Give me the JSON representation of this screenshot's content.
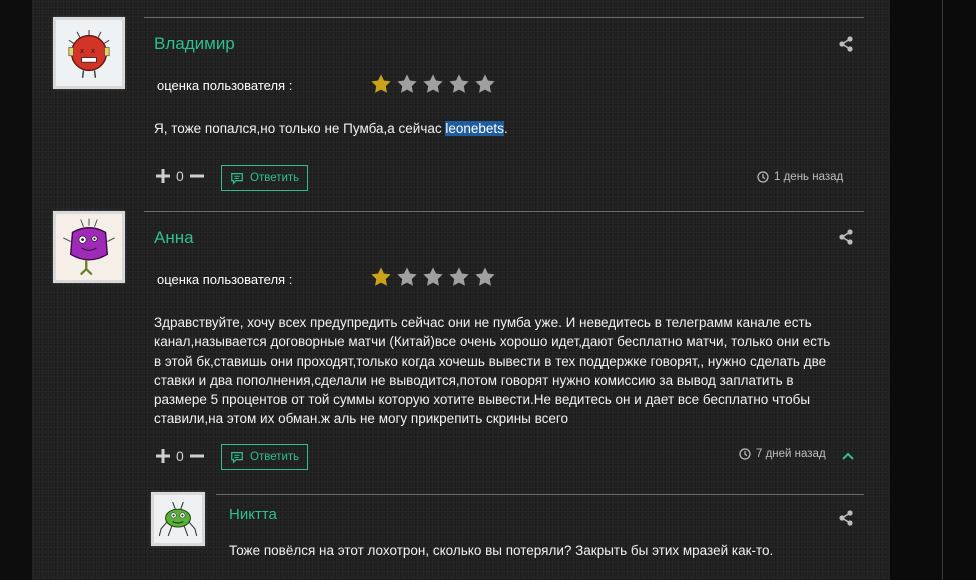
{
  "comments": [
    {
      "author": "Владимир",
      "rating_label": "оценка пользователя :",
      "rating": 1,
      "rating_max": 5,
      "text_before": "Я, тоже попался,но только не Пумба,а сейчас ",
      "text_highlight": "leonebets",
      "text_after": ".",
      "votes": "0",
      "reply_label": "Ответить",
      "time": "1 день назад"
    },
    {
      "author": "Анна",
      "rating_label": "оценка пользователя :",
      "rating": 1,
      "rating_max": 5,
      "text_lines": [
        "Здравствуйте, хочу всех предупредить сейчас они не пумба уже. И неведитесь в телеграмм канале есть",
        "канал,называется договорные матчи (Китай)все очень хорошо идет,дают бесплатно матчи, только они есть",
        "в этой бк,ставишь они проходят,только когда хочешь вывести в тех поддержке говорят,, нужно сделать две",
        "ставки и два пополнения,сделали не выводится,потом говорят нужно комиссию за вывод заплатить в",
        "размере 5 процентов от той суммы которую хотите вывести.Не ведитесь он и дает все бесплатно чтобы",
        "ставили,на этом их обман.ж аль не могу прикрепить скрины всего"
      ],
      "votes": "0",
      "reply_label": "Ответить",
      "time": "7 дней назад"
    },
    {
      "author": "Никтта",
      "text": "Тоже повёлся на этот лохотрон, сколько вы потеряли? Закрыть бы этих мразей как-то."
    }
  ],
  "colors": {
    "accent": "#2fbf8f",
    "star_active": "#c9a21a",
    "star_inactive": "#a0a0a0",
    "highlight": "#1f5d9e"
  },
  "icons": [
    "share-icon",
    "star-icon",
    "plus-icon",
    "minus-icon",
    "comment-icon",
    "clock-icon",
    "chevron-up-icon"
  ]
}
